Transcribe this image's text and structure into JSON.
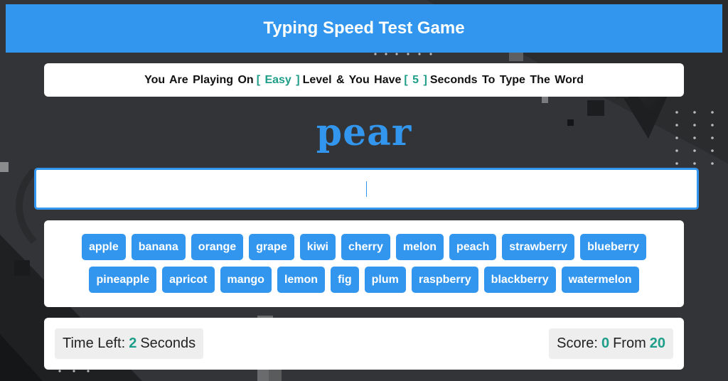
{
  "header": {
    "title": "Typing Speed Test Game"
  },
  "info": {
    "prefix": "You Are Playing On",
    "level": "[ Easy ]",
    "middle": "Level & You Have",
    "seconds": "[ 5 ]",
    "suffix": "Seconds To Type The Word"
  },
  "game": {
    "current_word": "pear",
    "input_value": ""
  },
  "words": {
    "row1": [
      "apple",
      "banana",
      "orange",
      "grape",
      "kiwi",
      "cherry",
      "melon",
      "peach",
      "strawberry",
      "blueberry"
    ],
    "row2": [
      "pineapple",
      "apricot",
      "mango",
      "lemon",
      "fig",
      "plum",
      "raspberry",
      "blackberry",
      "watermelon"
    ]
  },
  "status": {
    "time_label": "Time Left:",
    "time_value": "2",
    "time_unit": "Seconds",
    "score_label": "Score:",
    "score_value": "0",
    "score_from": "From",
    "score_total": "20"
  },
  "colors": {
    "accent": "#3396ee",
    "highlight": "#1e9e88",
    "background": "#333437"
  }
}
